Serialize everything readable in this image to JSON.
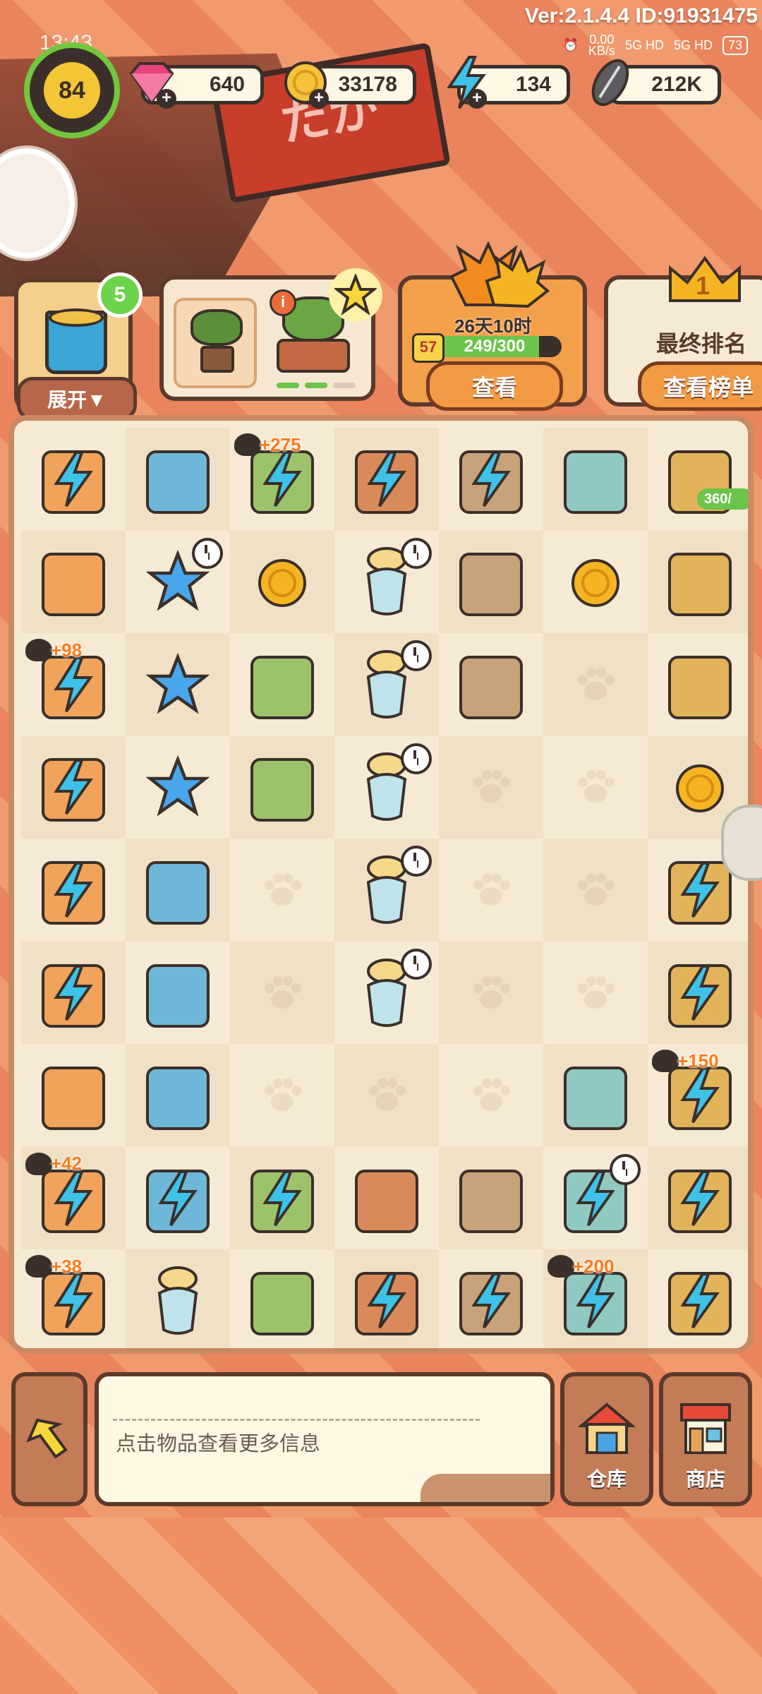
{
  "status_bar": {
    "version": "Ver:2.1.4.4 ID:91931475",
    "time": "13:43",
    "net_speed": "0.00\nKB/s",
    "net_speed_line1": "0.00",
    "net_speed_line2": "KB/s",
    "signal1": "5G HD",
    "signal2": "5G HD",
    "battery": "73"
  },
  "hud": {
    "level": "84",
    "gems": "640",
    "coins": "33178",
    "energy": "134",
    "seeds": "212K"
  },
  "orders": {
    "inventory_count": "5",
    "expand_label": "展开▼",
    "event_time": "26天10时",
    "event_level": "57",
    "event_progress": "249/300",
    "event_progress_value": 0.83,
    "view_label": "查看",
    "rank_number": "1",
    "rank_title": "最终排名",
    "rank_button": "查看榜单"
  },
  "board": {
    "pig_progress": "360/",
    "energy_tags": [
      "275",
      "98",
      "150",
      "42",
      "38",
      "200"
    ]
  },
  "bottom": {
    "info_text": "点击物品查看更多信息",
    "warehouse_label": "仓库",
    "shop_label": "商店"
  },
  "colors": {
    "outline": "#3a2f2a",
    "bolt": "#3fc2e8",
    "accent_orange": "#f29a44",
    "level_green": "#74c63e"
  },
  "icons": [
    "gem-icon",
    "coin-icon",
    "energy-bolt-icon",
    "sunflower-seed-icon",
    "paint-bucket-icon",
    "bonsai-icon",
    "star-icon",
    "maple-leaf-icon",
    "crown-icon",
    "cat-icon",
    "warehouse-icon",
    "shop-icon",
    "undo-arrow-icon"
  ]
}
